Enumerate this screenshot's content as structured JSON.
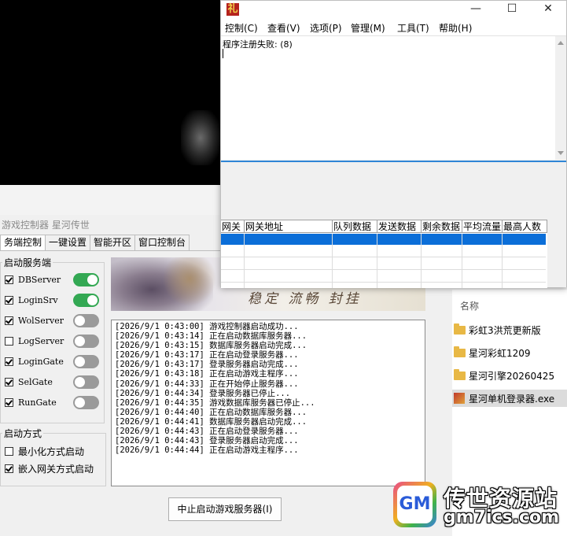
{
  "controller": {
    "title": "游戏控制器  星河传世",
    "tabs": [
      "务端控制",
      "一键设置",
      "智能开区",
      "窗口控制台"
    ],
    "start_group": {
      "legend": "启动服务端",
      "services": [
        {
          "label": "DBServer",
          "checked": true,
          "toggle": "on"
        },
        {
          "label": "LoginSrv",
          "checked": true,
          "toggle": "on"
        },
        {
          "label": "WolServer",
          "checked": true,
          "toggle": "off"
        },
        {
          "label": "LogServer",
          "checked": false,
          "toggle": "off"
        },
        {
          "label": "LoginGate",
          "checked": true,
          "toggle": "off"
        },
        {
          "label": "SelGate",
          "checked": true,
          "toggle": "off"
        },
        {
          "label": "RunGate",
          "checked": true,
          "toggle": "off"
        }
      ]
    },
    "mode_group": {
      "legend": "启动方式",
      "options": [
        {
          "label": "最小化方式启动",
          "checked": false
        },
        {
          "label": "嵌入网关方式启动",
          "checked": true
        }
      ]
    },
    "banner_slogan": "稳定 流畅 封挂",
    "log": [
      "[2026/9/1  0:43:00] 游戏控制器启动成功...",
      "[2026/9/1  0:43:14] 正在启动数据库服务器...",
      "[2026/9/1  0:43:15] 数据库服务器启动完成...",
      "[2026/9/1  0:43:17] 正在启动登录服务器...",
      "[2026/9/1  0:43:17] 登录服务器启动完成...",
      "[2026/9/1  0:43:18] 正在启动游戏主程序...",
      "[2026/9/1  0:44:33] 正在开始停止服务器...",
      "[2026/9/1  0:44:34] 登录服务器已停止...",
      "[2026/9/1  0:44:35] 游戏数据库服务器已停止...",
      "[2026/9/1  0:44:40] 正在启动数据库服务器...",
      "[2026/9/1  0:44:41] 数据库服务器启动完成...",
      "[2026/9/1  0:44:43] 正在启动登录服务器...",
      "[2026/9/1  0:44:43] 登录服务器启动完成...",
      "[2026/9/1  0:44:44] 正在启动游戏主程序..."
    ],
    "stop_button": "中止启动游戏服务器(I)"
  },
  "files": {
    "header": "名称",
    "items": [
      {
        "name": "彩虹3洪荒更新版",
        "type": "folder"
      },
      {
        "name": "星河彩虹1209",
        "type": "folder"
      },
      {
        "name": "星河引擎20260425",
        "type": "folder"
      },
      {
        "name": "星河单机登录器.exe",
        "type": "exe"
      }
    ]
  },
  "watermark": {
    "logo": "GM",
    "line1": "传世资源站",
    "line2": "gm7ics.com"
  },
  "window": {
    "icon_glyph": "礼",
    "controls": {
      "minimize": "—",
      "maximize": "☐",
      "close": "✕"
    },
    "menu": [
      "控制(C)",
      "查看(V)",
      "选项(P)",
      "管理(M)",
      "工具(T)",
      "帮助(H)"
    ],
    "message": "程序注册失败: (8)",
    "grid_headers": [
      "网关",
      "网关地址",
      "队列数据",
      "发送数据",
      "剩余数据",
      "平均流量",
      "最高人数"
    ]
  },
  "colors": {
    "toggle_on": "#33a853",
    "toggle_off": "#9a9a9a",
    "selection": "#0b6ed8",
    "divider": "#2f86d6"
  }
}
